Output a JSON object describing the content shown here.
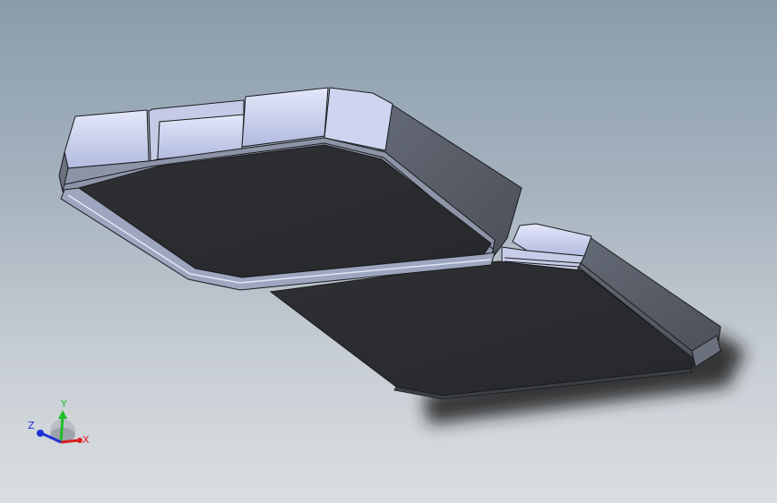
{
  "viewport": {
    "background_top": "#8a9cac",
    "background_bottom": "#dadee1"
  },
  "model": {
    "part_count": 2,
    "colors": {
      "top_face": "#2a2c30",
      "side_face": "#595e69",
      "rim_light": "#d6dcf4",
      "rim_mid": "#b9c1e2",
      "edge": "#1a1b1e",
      "shadow": "#1f1f1f"
    }
  },
  "triad": {
    "x_label": "X",
    "y_label": "Y",
    "z_label": "Z",
    "x_color": "#d82020",
    "y_color": "#1fbf2a",
    "z_color": "#2030d8",
    "icon": "view-orientation-triad-icon"
  }
}
